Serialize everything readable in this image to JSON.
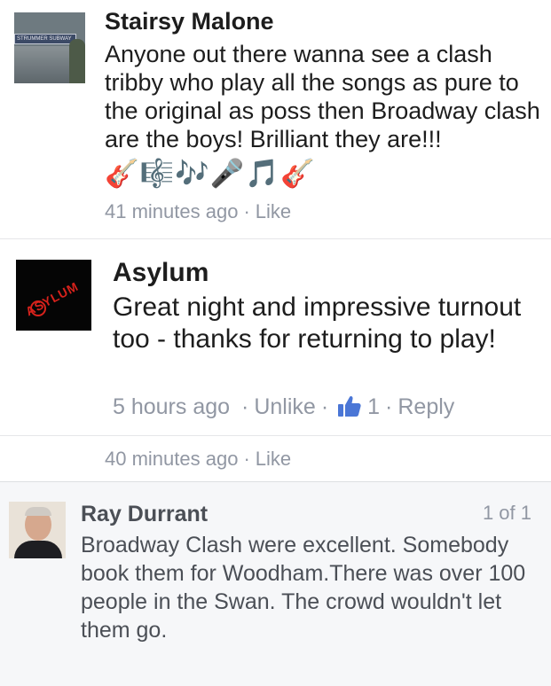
{
  "comment1": {
    "author": "Stairsy Malone",
    "avatar_sign": "STRUMMER SUBWAY",
    "text": "Anyone out there wanna see a clash tribby who play all the songs as pure to the original as poss then Broadway clash are the boys! Brilliant they are!!!",
    "emojis": "🎸🎼🎶🎤🎵🎸",
    "time": "41 minutes ago",
    "like_label": "Like"
  },
  "reply": {
    "author": "Asylum",
    "avatar_logo": "ASYLUM",
    "text": "Great night and impressive turnout too - thanks for returning to play!",
    "time": "5 hours ago",
    "unlike_label": "Unlike",
    "like_count": "1",
    "reply_label": "Reply"
  },
  "comment1_footer": {
    "time": "40 minutes ago",
    "like_label": "Like"
  },
  "comment3": {
    "author": "Ray Durrant",
    "count": "1 of 1",
    "text": "Broadway Clash were excellent. Somebody book them for Woodham.There was over 100 people in the Swan. The crowd wouldn't let them go."
  },
  "colors": {
    "meta_gray": "#9197a3",
    "like_blue": "#4a76d6",
    "highlight_bg": "#f6f7f9"
  }
}
